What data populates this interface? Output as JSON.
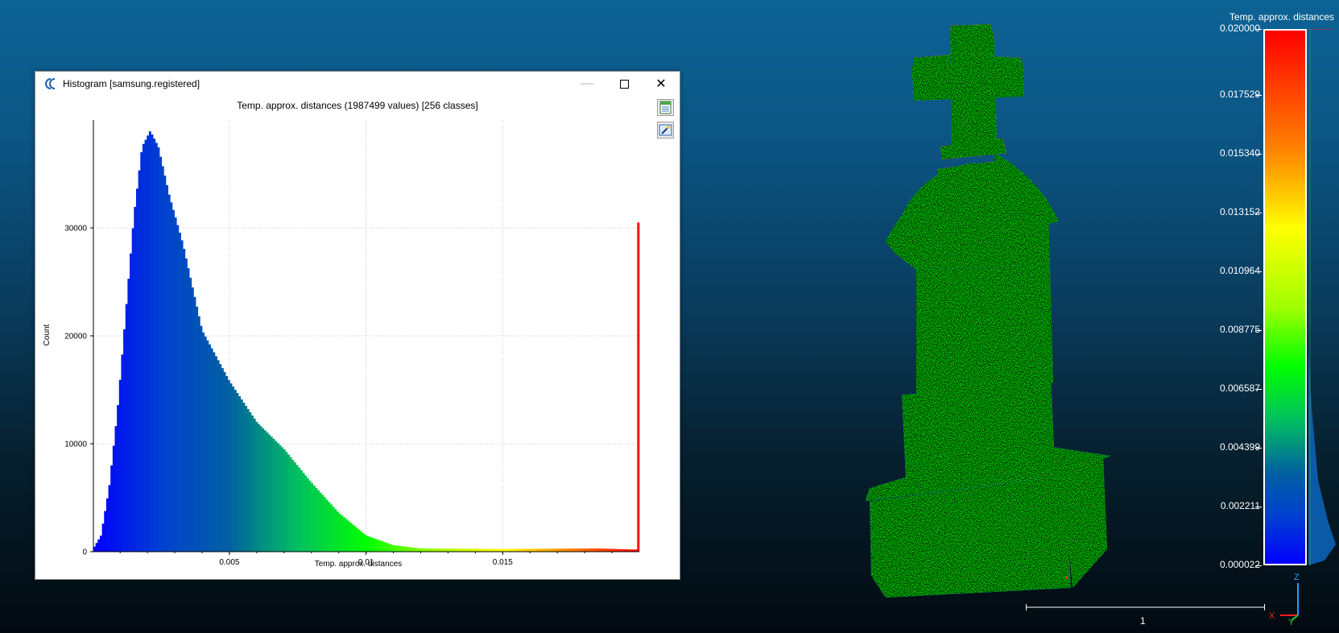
{
  "histogram_window": {
    "title": "Histogram [samsung.registered]",
    "minimize_glyph": "—",
    "maximize_glyph": "☐",
    "close_glyph": "✕",
    "tools": [
      "export-csv-icon",
      "export-image-icon"
    ]
  },
  "chart_data": {
    "type": "bar",
    "title": "Temp. approx. distances (1987499 values)  [256 classes]",
    "xlabel": "Temp. approx. distances",
    "ylabel": "Count",
    "classes": 256,
    "value_count": 1987499,
    "x_range": [
      2.2e-05,
      0.02
    ],
    "xlim": [
      2.2e-05,
      0.02
    ],
    "ylim": [
      0,
      40000
    ],
    "grid": true,
    "x_ticks": [
      0.005,
      0.01,
      0.015
    ],
    "x_tick_labels": [
      "0.005",
      "0.01",
      "0.015"
    ],
    "y_ticks": [
      0,
      10000,
      20000,
      30000
    ],
    "y_tick_labels": [
      "0",
      "10000",
      "20000",
      "30000"
    ],
    "profile_x": [
      2.2e-05,
      0.0003,
      0.0006,
      0.0009,
      0.0012,
      0.0015,
      0.0018,
      0.0021,
      0.0024,
      0.0028,
      0.0033,
      0.004,
      0.005,
      0.006,
      0.007,
      0.008,
      0.009,
      0.01,
      0.011,
      0.012,
      0.015,
      0.0185,
      0.01975
    ],
    "profile_y": [
      300,
      1500,
      6000,
      13000,
      22000,
      31000,
      37500,
      39000,
      37500,
      33000,
      28500,
      20500,
      15800,
      12000,
      9500,
      6400,
      3600,
      1500,
      600,
      300,
      250,
      300,
      200
    ],
    "last_class_count": 30500,
    "colormap": [
      "#0000ff",
      "#0040d0",
      "#0060a0",
      "#00c060",
      "#00ff00",
      "#a0ff00",
      "#ffff00",
      "#ff8000",
      "#ff0000"
    ]
  },
  "color_scale": {
    "title": "Temp. approx. distances",
    "ticks": [
      "0.020000",
      "0.017529",
      "0.015340",
      "0.013152",
      "0.010964",
      "0.008775",
      "0.006587",
      "0.004399",
      "0.002211",
      "0.000022"
    ],
    "max": 0.02,
    "min": 2.2e-05
  },
  "axis": {
    "x": "X",
    "y": "Y",
    "z": "Z",
    "colors": {
      "x": "#ff2020",
      "y": "#20d020",
      "z": "#20a0ff"
    }
  },
  "scale_bar_label": "1"
}
